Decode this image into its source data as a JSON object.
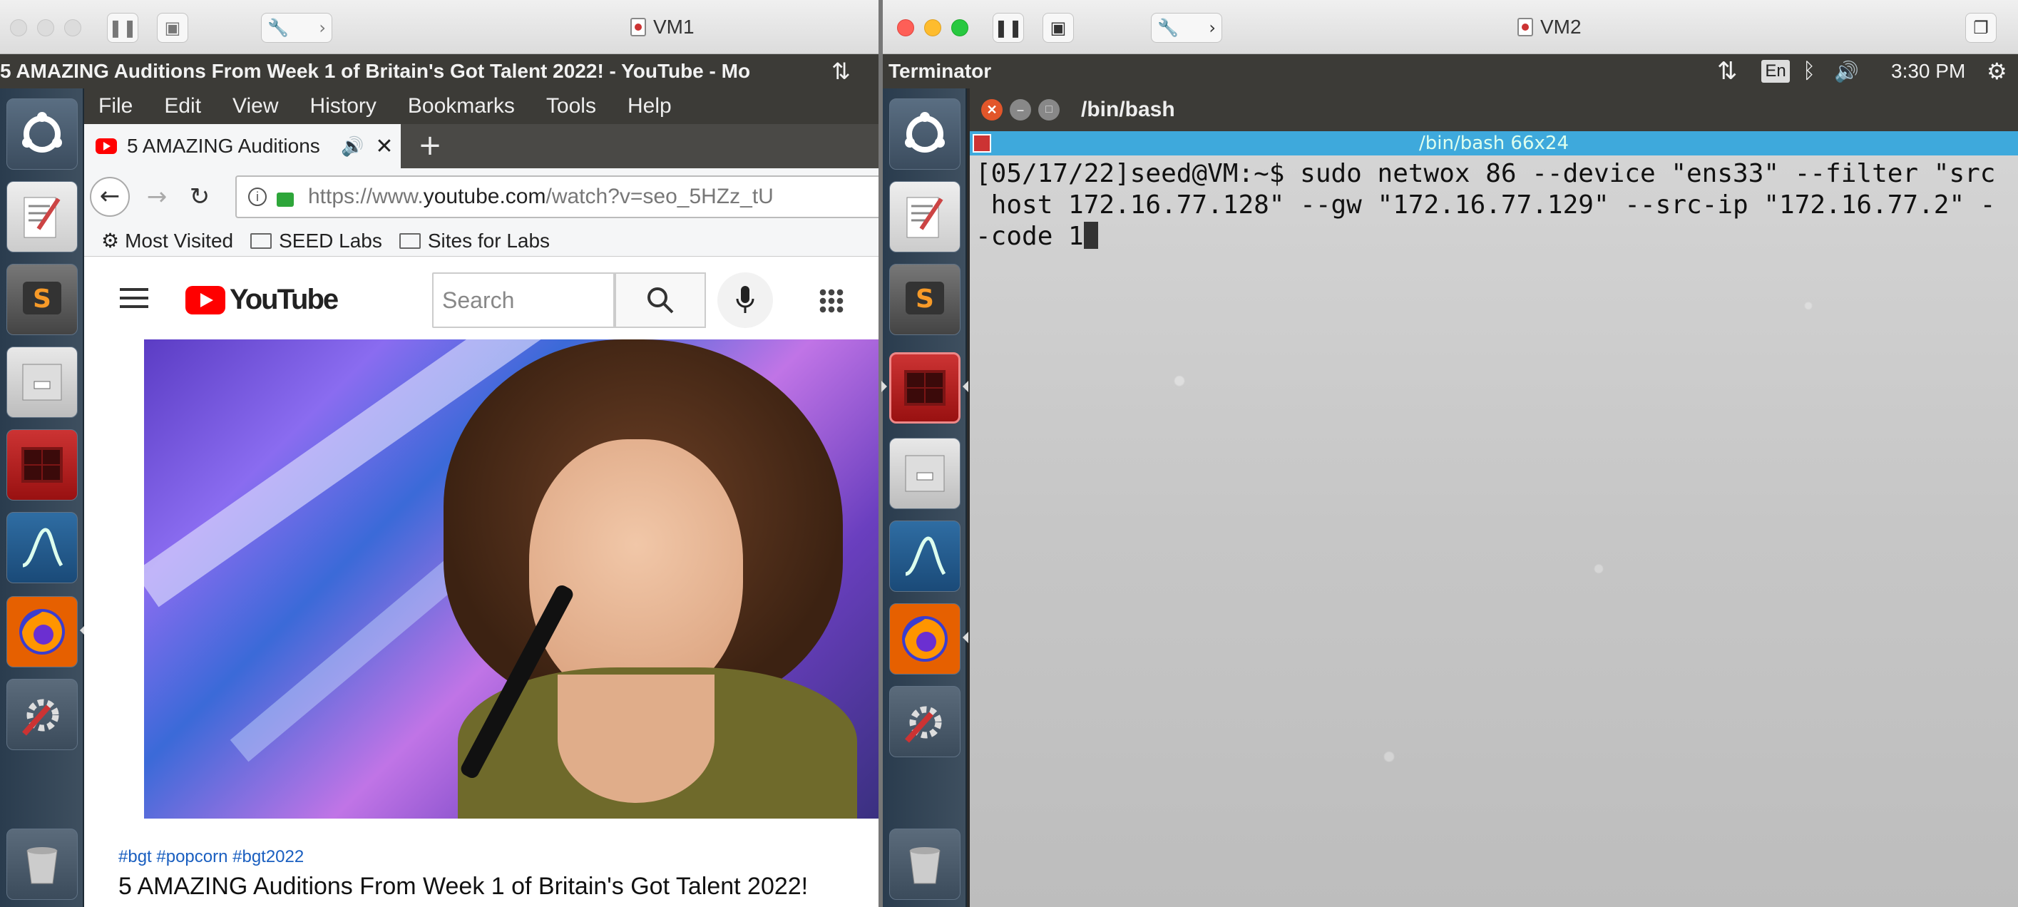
{
  "vm1": {
    "window_title": "VM1",
    "panel_title": "5 AMAZING Auditions From Week 1 of Britain's Got Talent 2022! - YouTube - Mo",
    "menu": [
      "File",
      "Edit",
      "View",
      "History",
      "Bookmarks",
      "Tools",
      "Help"
    ],
    "tab": {
      "title": "5 AMAZING Auditions",
      "new_tab": "+"
    },
    "url": {
      "prefix": "https://www.",
      "domain": "youtube.com",
      "path": "/watch?v=seo_5HZz_tU"
    },
    "bookmarks": [
      "Most Visited",
      "SEED Labs",
      "Sites for Labs"
    ],
    "youtube": {
      "logo_text": "YouTube",
      "search_placeholder": "Search",
      "hashtags": "#bgt #popcorn #bgt2022",
      "video_title": "5 AMAZING Auditions From Week 1 of Britain's Got Talent 2022!"
    }
  },
  "vm2": {
    "window_title": "VM2",
    "panel_app": "Terminator",
    "indicators": {
      "keyboard": "En",
      "time": "3:30 PM"
    },
    "terminal": {
      "title": "/bin/bash",
      "subtitle": "/bin/bash 66x24",
      "lines": [
        "[05/17/22]seed@VM:~$ sudo netwox 86 --device \"ens33\" --filter \"src",
        " host 172.16.77.128\" --gw \"172.16.77.129\" --src-ip \"172.16.77.2\" -",
        "-code 1"
      ]
    }
  },
  "colors": {
    "ubuntu_panel": "#3c3b37",
    "terminal_tab": "#3ea9dc",
    "youtube_red": "#ff0000",
    "launcher": "#2e4050"
  }
}
